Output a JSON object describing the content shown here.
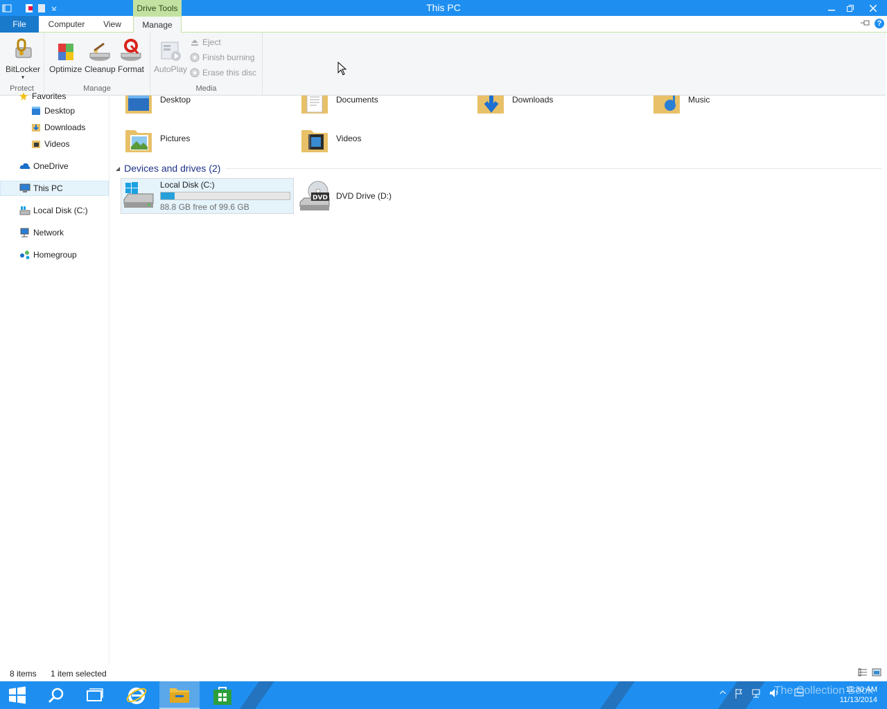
{
  "window": {
    "title": "This PC",
    "context_tab_label": "Drive Tools",
    "controls": {
      "minimize": "minimize",
      "restore": "restore",
      "close": "close"
    }
  },
  "ribbon": {
    "tabs": [
      "File",
      "Computer",
      "View",
      "Manage"
    ],
    "active_tab": "Manage",
    "groups": {
      "protect": {
        "label": "Protect",
        "buttons": [
          "BitLocker"
        ]
      },
      "manage": {
        "label": "Manage",
        "buttons": [
          "Optimize",
          "Cleanup",
          "Format"
        ]
      },
      "media": {
        "label": "Media",
        "big_button": "AutoPlay",
        "small_buttons": [
          "Eject",
          "Finish burning",
          "Erase this disc"
        ]
      }
    }
  },
  "nav": {
    "favorites_label": "Favorites",
    "items": [
      {
        "label": "Desktop",
        "icon": "desktop-icon"
      },
      {
        "label": "Downloads",
        "icon": "downloads-icon"
      },
      {
        "label": "Videos",
        "icon": "videos-icon"
      },
      {
        "label": "OneDrive",
        "icon": "onedrive-icon"
      },
      {
        "label": "This PC",
        "icon": "this-pc-icon",
        "selected": true
      },
      {
        "label": "Local Disk (C:)",
        "icon": "local-disk-icon"
      },
      {
        "label": "Network",
        "icon": "network-icon"
      },
      {
        "label": "Homegroup",
        "icon": "homegroup-icon"
      }
    ]
  },
  "folders": [
    {
      "label": "Desktop",
      "icon": "desktop-folder-icon"
    },
    {
      "label": "Documents",
      "icon": "documents-folder-icon"
    },
    {
      "label": "Downloads",
      "icon": "downloads-folder-icon"
    },
    {
      "label": "Music",
      "icon": "music-folder-icon"
    },
    {
      "label": "Pictures",
      "icon": "pictures-folder-icon"
    },
    {
      "label": "Videos",
      "icon": "videos-folder-icon"
    }
  ],
  "devices": {
    "header": "Devices and drives (2)",
    "drives": [
      {
        "label": "Local Disk (C:)",
        "free_text": "88.8 GB free of 99.6 GB",
        "used_fraction": 0.108,
        "selected": true
      },
      {
        "label": "DVD Drive (D:)",
        "badge": "DVD"
      }
    ]
  },
  "status": {
    "item_count": "8 items",
    "selection": "1 item selected"
  },
  "taskbar": {
    "apps": [
      "start-icon",
      "search-icon",
      "task-view-icon",
      "internet-explorer-icon",
      "file-explorer-icon",
      "store-icon"
    ],
    "active_app": "file-explorer-icon",
    "watermark": "The Collection Book",
    "time": "11:30 AM",
    "date": "11/13/2014"
  },
  "colors": {
    "accent": "#1e8ff1",
    "context_green": "#c3e2a2",
    "file_tab": "#1979ca",
    "selection": "#e5f3fb"
  }
}
